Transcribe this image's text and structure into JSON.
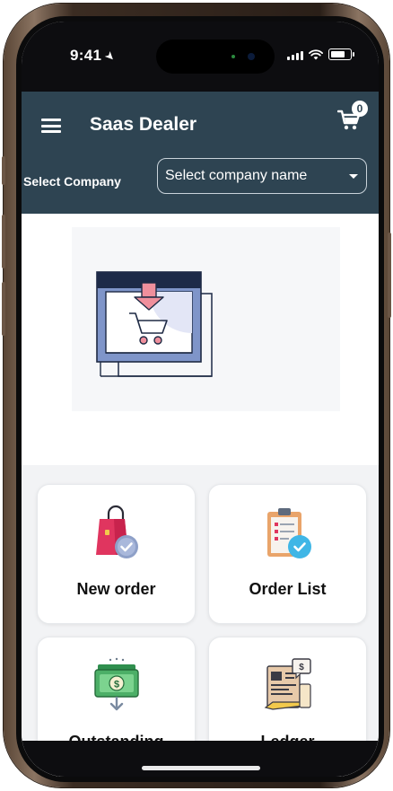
{
  "status_bar": {
    "time": "9:41",
    "location_arrow": "location-arrow-icon"
  },
  "header": {
    "title": "Saas Dealer",
    "cart_count": "0",
    "company_label": "Select Company",
    "company_placeholder": "Select company name"
  },
  "tiles": [
    {
      "label": "New order",
      "icon": "shopping-bag-check-icon"
    },
    {
      "label": "Order List",
      "icon": "clipboard-check-icon"
    },
    {
      "label": "Outstanding",
      "icon": "money-stack-icon"
    },
    {
      "label": "Ledger",
      "icon": "ledger-invoice-icon"
    }
  ],
  "colors": {
    "header_bg": "#2e4452",
    "status_bg": "#0d0d10",
    "tile_bg": "#ffffff",
    "page_bg": "#f2f3f5"
  }
}
